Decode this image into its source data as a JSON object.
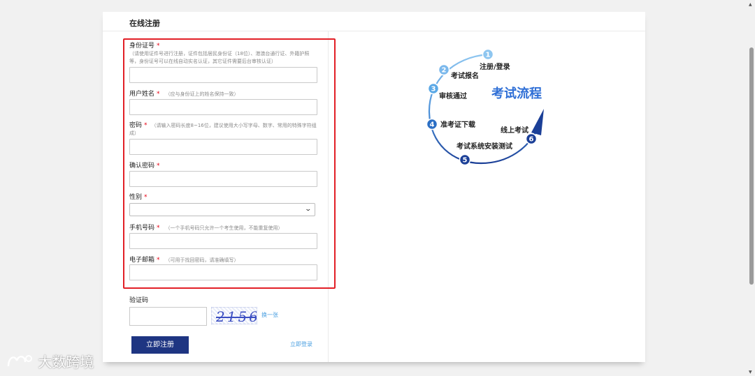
{
  "page": {
    "title": "在线注册"
  },
  "form": {
    "id_number": {
      "label": "身份证号",
      "required": "*",
      "hint": "（请使用证件号进行注册，证件包括居民身份证（18位）、港澳台通行证、外籍护照等，身份证号可以在线自动实名认证，其它证件需要后台审核认证）",
      "value": ""
    },
    "name": {
      "label": "用户姓名",
      "required": "*",
      "hint": "（应与身份证上的姓名保持一致）",
      "value": ""
    },
    "password": {
      "label": "密码",
      "required": "*",
      "hint": "（请输入密码长度8~16位，建议使用大小写字母、数字、常用的特殊字符组成）",
      "value": ""
    },
    "confirm_password": {
      "label": "确认密码",
      "required": "*",
      "value": ""
    },
    "gender": {
      "label": "性别",
      "required": "*",
      "selected": ""
    },
    "phone": {
      "label": "手机号码",
      "required": "*",
      "hint": "（一个手机号码只允许一个考生使用，不能重复使用）",
      "value": ""
    },
    "email": {
      "label": "电子邮箱",
      "required": "*",
      "hint": "（可用于找回密码，请准确填写）",
      "value": ""
    },
    "captcha": {
      "label": "验证码",
      "image_text": "2156",
      "refresh_label": "换一张",
      "value": ""
    },
    "submit_label": "立即注册",
    "login_link": "立即登录"
  },
  "flow": {
    "title": "考试流程",
    "steps": [
      {
        "num": "1",
        "label": "注册/登录"
      },
      {
        "num": "2",
        "label": "考试报名"
      },
      {
        "num": "3",
        "label": "审核通过"
      },
      {
        "num": "4",
        "label": "准考证下载"
      },
      {
        "num": "5",
        "label": "考试系统安装测试"
      },
      {
        "num": "6",
        "label": "线上考试"
      }
    ],
    "colors": {
      "light": "#5aa8e6",
      "dark": "#1b3f97",
      "title": "#2f6fd6"
    }
  },
  "watermark": {
    "text": "大数跨境"
  },
  "icons": {
    "select_arrow": "chevron-down-icon",
    "watermark_logo": "brand-logo-icon"
  }
}
